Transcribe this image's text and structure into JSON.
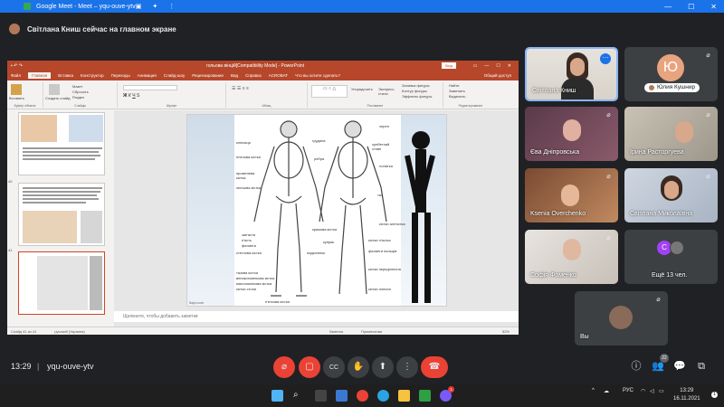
{
  "browser": {
    "tab_title": "Google Meet - Meet – yqu-ouve-ytv",
    "accent": "#1a73e8"
  },
  "presenting_banner": {
    "text": "Світлана Книш сейчас на главном экране"
  },
  "powerpoint": {
    "window_title": "гольова вінцій[Compatibility Mode] - PowerPoint",
    "sign_in": "Вхід",
    "tabs": [
      "Файл",
      "Главная",
      "Вставка",
      "Конструктор",
      "Переходы",
      "Анимация",
      "Слайд-шоу",
      "Рецензирование",
      "Вид",
      "Справка",
      "ACROBAT",
      "Что вы хотите сделать?"
    ],
    "share": "Общий доступ",
    "ribbon_groups": [
      "Буфер обмена",
      "Слайды",
      "Шрифт",
      "Абзац",
      "Рисование",
      "Редактирование"
    ],
    "ribbon_buttons": {
      "paste": "Вставить",
      "new_slide": "Создать слайд",
      "layout": "Макет",
      "reset": "Сбросить",
      "section": "Раздел",
      "arrange": "Упорядочить",
      "quick_styles": "Экспресс-стили",
      "shape_fill": "Заливка фигуры",
      "shape_outline": "Контур фигуры",
      "shape_effects": "Эффекты фигуры",
      "find": "Найти",
      "replace": "Заменить",
      "select": "Выделить"
    },
    "thumbnails": [
      {
        "num": "39",
        "selected": false
      },
      {
        "num": "40",
        "selected": false
      },
      {
        "num": "41",
        "selected": true
      }
    ],
    "notes_placeholder": "Щелкните, чтобы добавить заметки",
    "status": {
      "slide": "Слайд 41 из 41",
      "language": "русский (Украина)",
      "notes": "Заметки",
      "comments": "Примечания",
      "zoom": "52%"
    },
    "watermark": "5apl.com",
    "skeleton_labels_left": [
      "ключиця",
      "грудина",
      "плечова кістка",
      "променева кістка",
      "ліктьова кістка",
      "зап'ястя",
      "п'ясть",
      "фаланги",
      "стегнова кістка",
      "надколінок",
      "тазова кістка",
      "великогомілкова кістка",
      "малогомілкова кістка",
      "кістки стопи",
      "п'яткова кістка"
    ],
    "skeleton_labels_right": [
      "череп",
      "хребетний стовп",
      "лопатка",
      "ребра",
      "таз",
      "кістки зап'ястка",
      "кістки п'ястка",
      "фаланги пальців",
      "крижова кістка",
      "куприк",
      "кістки передплесна",
      "кістки плесна"
    ]
  },
  "participants": [
    {
      "name": "Світлана Книш",
      "muted": false,
      "speaking": true
    },
    {
      "name": "Юлия Кушнир",
      "initial": "Ю",
      "muted": true
    },
    {
      "name": "Єва Дніпровська",
      "muted": true
    },
    {
      "name": "Ірина Расторгуева",
      "muted": true
    },
    {
      "name": "Ksenia Overchenko",
      "muted": true
    },
    {
      "name": "Світлана Миколаївна",
      "muted": true
    },
    {
      "name": "Софія Фоменко",
      "muted": true
    },
    {
      "name": "Ещё 13 чел.",
      "initial": "С"
    },
    {
      "name": "Вы",
      "muted": true
    }
  ],
  "bottom": {
    "time": "13:29",
    "separator": "|",
    "meeting_code": "yqu-ouve-ytv",
    "participant_count": "22"
  },
  "taskbar": {
    "lang": "РУС",
    "clock_time": "13:29",
    "clock_date": "16.11.2021",
    "chat_badge": "1"
  },
  "colors": {
    "meet_bg": "#202124",
    "tile_bg": "#3c4043",
    "end_call": "#ea4335",
    "ppt_red": "#b7472a"
  }
}
